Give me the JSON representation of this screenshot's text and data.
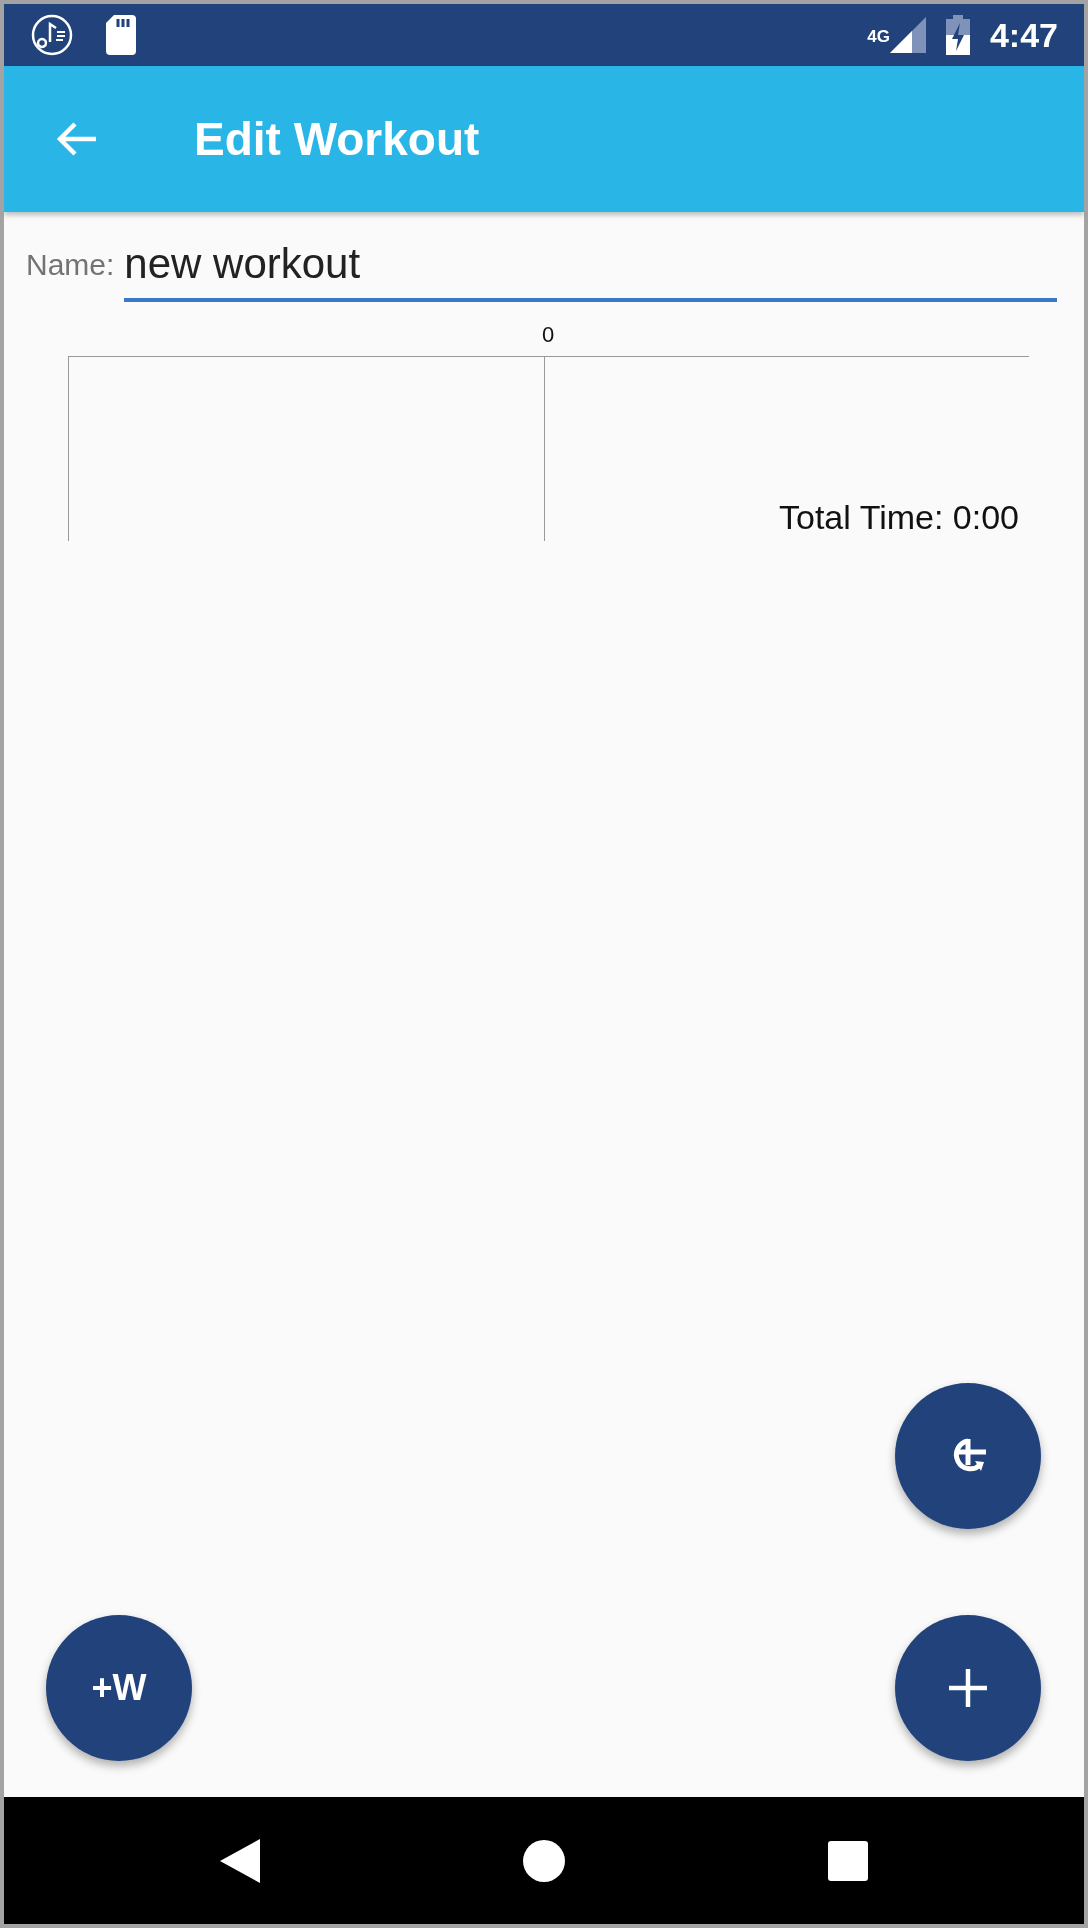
{
  "status_bar": {
    "network": "4G",
    "time": "4:47"
  },
  "app_bar": {
    "title": "Edit Workout"
  },
  "name_field": {
    "label": "Name:",
    "value": "new workout"
  },
  "timeline": {
    "tick": "0",
    "total": "Total Time: 0:00"
  },
  "fabs": [
    {
      "kind": "repeat"
    },
    {
      "kind": "text",
      "label": "+W"
    },
    {
      "kind": "add"
    }
  ]
}
